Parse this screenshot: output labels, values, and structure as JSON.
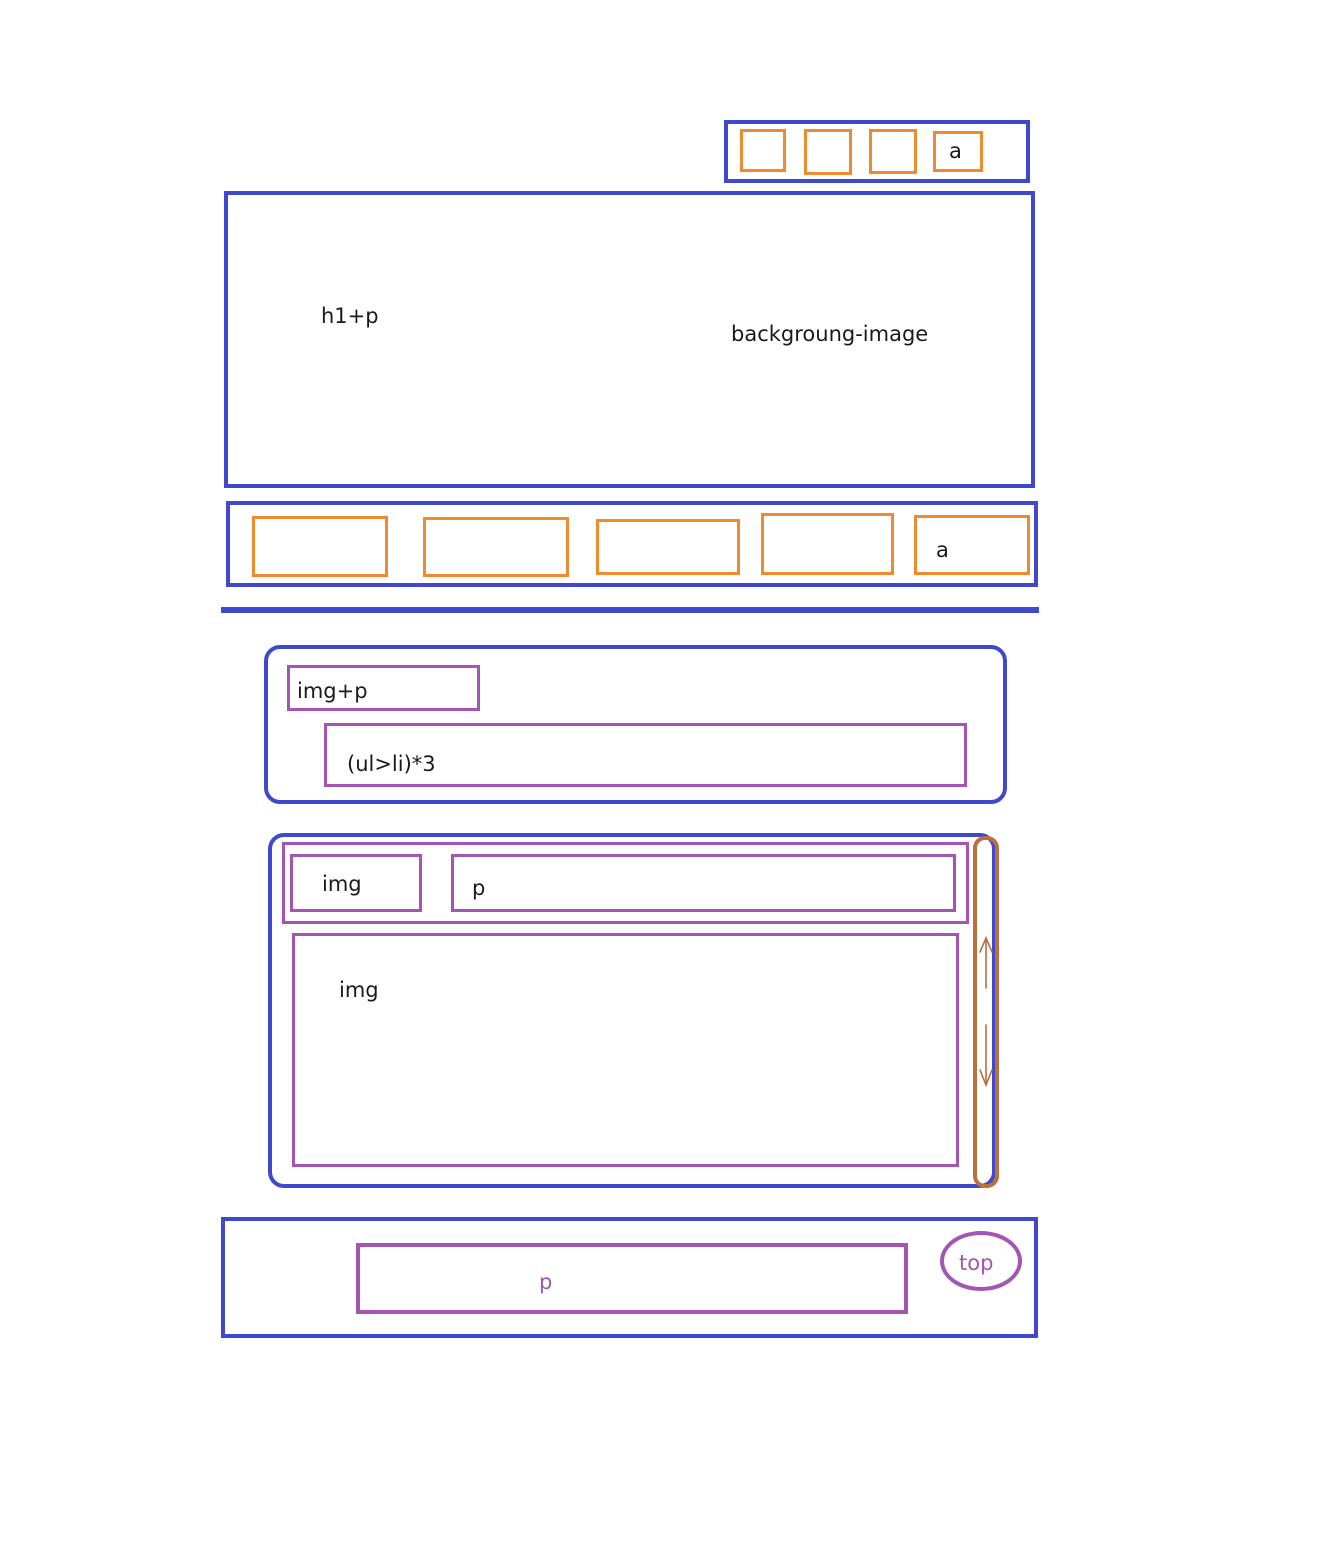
{
  "colors": {
    "blue": "#4048cc",
    "orange": "#f08a2e",
    "purple": "#a455b4",
    "brown": "#b8703f"
  },
  "top_nav": {
    "last_label": "a"
  },
  "banner": {
    "left_label": "h1+p",
    "right_label": "backgroung-image"
  },
  "menu": {
    "last_label": "a"
  },
  "section_one": {
    "title_label": "img+p",
    "list_label": "(ul>li)*3"
  },
  "section_two": {
    "thumb_label": "img",
    "text_label": "p",
    "image_label": "img",
    "scroll_icon": "up-down-arrow-icon"
  },
  "footer": {
    "text_label": "p",
    "top_label": "top"
  }
}
